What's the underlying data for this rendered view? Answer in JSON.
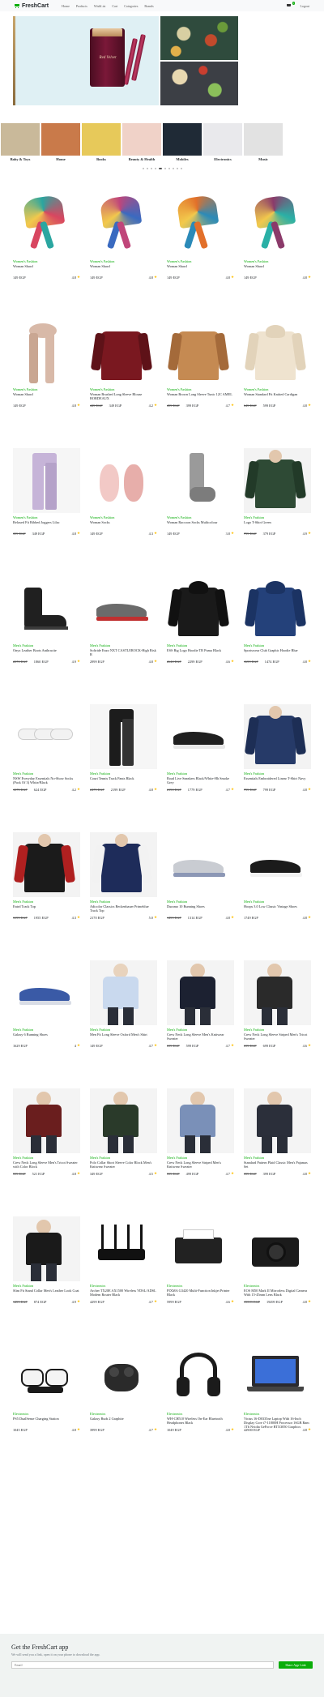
{
  "navbar": {
    "brand": "FreshCart",
    "links": [
      "Home",
      "Products",
      "WishList",
      "Cart",
      "Categories",
      "Brands"
    ],
    "cart_count": "1",
    "signout": "Logout"
  },
  "hero": {
    "tin_label": "Red Velvet"
  },
  "categories": [
    {
      "name": "Baby & Toys",
      "color": "#c9b99a"
    },
    {
      "name": "Home",
      "color": "#c97a4a"
    },
    {
      "name": "Books",
      "color": "#e7c95a"
    },
    {
      "name": "Beauty & Health",
      "color": "#f0d2c8"
    },
    {
      "name": "Mobiles",
      "color": "#1f2a36"
    },
    {
      "name": "Electronics",
      "color": "#e9e9ec"
    },
    {
      "name": "Music",
      "color": "#e2e2e2"
    }
  ],
  "products": [
    {
      "category": "Women's Fashion",
      "title": "Woman Shawl",
      "old_price": "",
      "price": "149 EGP",
      "rating": "4.8",
      "img": "scarf",
      "c1": "#2aa6a0",
      "c2": "#d84660"
    },
    {
      "category": "Women's Fashion",
      "title": "Woman Shawl",
      "old_price": "",
      "price": "149 EGP",
      "rating": "4.8",
      "img": "scarf",
      "c1": "#c0467a",
      "c2": "#3a6ac0"
    },
    {
      "category": "Women's Fashion",
      "title": "Woman Shawl",
      "old_price": "",
      "price": "149 EGP",
      "rating": "4.8",
      "img": "scarf",
      "c1": "#e2702a",
      "c2": "#2b8ab8"
    },
    {
      "category": "Women's Fashion",
      "title": "Woman Shawl",
      "old_price": "",
      "price": "149 EGP",
      "rating": "4.8",
      "img": "scarf",
      "c1": "#8b3a6a",
      "c2": "#2ab0a6"
    },
    {
      "category": "Women's Fashion",
      "title": "Woman Shawl",
      "old_price": "",
      "price": "149 EGP",
      "rating": "4.8",
      "img": "longscarf",
      "c1": "#d8b9a8",
      "c2": "#c9a692"
    },
    {
      "category": "Women's Fashion",
      "title": "Woman Brushed Long Sleeve Blouse BORDEAUX",
      "old_price": "449 EGP",
      "price": "349 EGP",
      "rating": "4.2",
      "img": "shirt",
      "c1": "#7a1820",
      "c2": "#5e1218"
    },
    {
      "category": "Women's Fashion",
      "title": "Woman Brown Long Sleeve Tunic 12C AMEL",
      "old_price": "499 EGP",
      "price": "399 EGP",
      "rating": "4.7",
      "img": "shirt",
      "c1": "#c58a52",
      "c2": "#a46a3a"
    },
    {
      "category": "Women's Fashion",
      "title": "Woman Standard Fit Knitted Cardigan",
      "old_price": "649 EGP",
      "price": "599 EGP",
      "rating": "4.8",
      "img": "hoodie",
      "c1": "#efe3cf",
      "c2": "#e2d3ba"
    },
    {
      "category": "Women's Fashion",
      "title": "Relaxed Fit Ribbed Joggers Lilac",
      "old_price": "399 EGP",
      "price": "349 EGP",
      "rating": "4.8",
      "img": "jogger",
      "c1": "#c6b4d8",
      "c2": "#b5a2c9"
    },
    {
      "category": "Women's Fashion",
      "title": "Woman Socks",
      "old_price": "",
      "price": "149 EGP",
      "rating": "4.3",
      "img": "slipper",
      "c1": "#f2c9c6",
      "c2": "#e7aeaa"
    },
    {
      "category": "Women's Fashion",
      "title": "Woman Raccoon Socks Multicolour",
      "old_price": "",
      "price": "149 EGP",
      "rating": "3.8",
      "img": "sock",
      "c1": "#9a9a9a",
      "c2": "#7c7c7c"
    },
    {
      "category": "Men's Fashion",
      "title": "Logo T-Shirt Green",
      "old_price": "799 EGP",
      "price": "379 EGP",
      "rating": "4.9",
      "img": "tee",
      "c1": "#2e4a35",
      "c2": "#223a28"
    },
    {
      "category": "Men's Fashion",
      "title": "Onyx Leather Boots Anthracite",
      "old_price": "2070 EGP",
      "price": "1860 EGP",
      "rating": "4.9",
      "img": "boot",
      "c1": "#202020",
      "c2": "#3a3a3a"
    },
    {
      "category": "Men's Fashion",
      "title": "Softride Enzo NXT CASTLEROCK-High Risk R",
      "old_price": "",
      "price": "2999 EGP",
      "rating": "4.8",
      "img": "shoe",
      "c1": "#6b6b6b",
      "c2": "#c03030"
    },
    {
      "category": "Men's Fashion",
      "title": "ESS Big Logo Hoodie TR Puma Black",
      "old_price": "2640 EGP",
      "price": "2299 EGP",
      "rating": "4.6",
      "img": "hoodie",
      "c1": "#1a1a1a",
      "c2": "#111"
    },
    {
      "category": "Men's Fashion",
      "title": "Sportswear Club Graphic Hoodie Blue",
      "old_price": "1699 EGP",
      "price": "1474 EGP",
      "rating": "4.8",
      "img": "hoodie",
      "c1": "#24417a",
      "c2": "#1b3363"
    },
    {
      "category": "Men's Fashion",
      "title": "NSW Everyday Essentials No-Show Socks (Pack Of 3) White/Black",
      "old_price": "1075 EGP",
      "price": "624 EGP",
      "rating": "4.2",
      "img": "socks3",
      "c1": "#f2f2f2",
      "c2": "#222"
    },
    {
      "category": "Men's Fashion",
      "title": "Court Tennis Track Pants Black",
      "old_price": "2479 EGP",
      "price": "2199 EGP",
      "rating": "4.8",
      "img": "pants",
      "c1": "#1c1c1c",
      "c2": "#333"
    },
    {
      "category": "Men's Fashion",
      "title": "Road Live Sneakers Black/White-Hh Smoke Grey",
      "old_price": "2190 EGP",
      "price": "1779 EGP",
      "rating": "4.7",
      "img": "shoe",
      "c1": "#1f1f1f",
      "c2": "#e8e8e8"
    },
    {
      "category": "Men's Fashion",
      "title": "Essentials Embroidered Linear T-Shirt Navy",
      "old_price": "799 EGP",
      "price": "799 EGP",
      "rating": "4.8",
      "img": "tee",
      "c1": "#263a68",
      "c2": "#1d2e55"
    },
    {
      "category": "Men's Fashion",
      "title": "Entrd Track Top",
      "old_price": "3199 EGP",
      "price": "1955 EGP",
      "rating": "4.3",
      "img": "jacket",
      "c1": "#1b1b1b",
      "c2": "#b02020"
    },
    {
      "category": "Men's Fashion",
      "title": "Adicolor Classics Beckenbauer Primeblue Track Top",
      "old_price": "",
      "price": "2170 EGP",
      "rating": "5.0",
      "img": "jacket",
      "c1": "#1e2c5a",
      "c2": "#f2f2f2"
    },
    {
      "category": "Men's Fashion",
      "title": "Duramo 10 Running Shoes",
      "old_price": "1499 EGP",
      "price": "1314 EGP",
      "rating": "4.8",
      "img": "shoe",
      "c1": "#c9ccd2",
      "c2": "#8c97b5"
    },
    {
      "category": "Men's Fashion",
      "title": "Hoops 3.0 Low Classic Vintage Shoes",
      "old_price": "",
      "price": "1749 EGP",
      "rating": "4.8",
      "img": "shoe",
      "c1": "#1b1b1b",
      "c2": "#f2f2f2"
    },
    {
      "category": "Men's Fashion",
      "title": "Galaxy 6 Running Shoes",
      "old_price": "",
      "price": "1629 EGP",
      "rating": "4",
      "img": "shoe",
      "c1": "#3a5aa6",
      "c2": "#d9dde6"
    },
    {
      "category": "Men's Fashion",
      "title": "Men Fit Long Sleeve Oxford Men's Shirt",
      "old_price": "",
      "price": "149 EGP",
      "rating": "4.7",
      "img": "manshirt",
      "c1": "#c9d9ee",
      "c2": "#e8d3bd"
    },
    {
      "category": "Men's Fashion",
      "title": "Crew Neck Long Sleeve Men's Knitwear Sweater",
      "old_price": "699 EGP",
      "price": "599 EGP",
      "rating": "4.7",
      "img": "mansweater",
      "c1": "#1c2131",
      "c2": "#e2c7ad"
    },
    {
      "category": "Men's Fashion",
      "title": "Crew Neck Long Sleeve Striped Men's Tricot Sweater",
      "old_price": "699 EGP",
      "price": "699 EGP",
      "rating": "4.6",
      "img": "mansweater",
      "c1": "#2a2a2a",
      "c2": "#e2c7ad"
    },
    {
      "category": "Men's Fashion",
      "title": "Crew Neck Long Sleeve Men's Tricot Sweater with Color Block",
      "old_price": "599 EGP",
      "price": "521 EGP",
      "rating": "4.8",
      "img": "mansweater",
      "c1": "#6a1e1e",
      "c2": "#e2c7ad"
    },
    {
      "category": "Men's Fashion",
      "title": "Polo Collar Short Sleeve Color Block Men's Knitwear Sweater",
      "old_price": "",
      "price": "349 EGP",
      "rating": "4.5",
      "img": "mansweater",
      "c1": "#2a3a2a",
      "c2": "#e2c7ad"
    },
    {
      "category": "Men's Fashion",
      "title": "Crew Neck Long Sleeve Striped Men's Knitwear Sweater",
      "old_price": "599 EGP",
      "price": "499 EGP",
      "rating": "4.7",
      "img": "mansweater",
      "c1": "#7a90b8",
      "c2": "#e2c7ad"
    },
    {
      "category": "Men's Fashion",
      "title": "Standard Pattern Plaid Classic Men's Pajamas Set",
      "old_price": "399 EGP",
      "price": "399 EGP",
      "rating": "4.8",
      "img": "mansweater",
      "c1": "#2b2f3a",
      "c2": "#e2c7ad"
    },
    {
      "category": "Men's Fashion",
      "title": "Slim Fit Stand Collar Men's Leather Look Coat",
      "old_price": "1499 EGP",
      "price": "874 EGP",
      "rating": "4.9",
      "img": "mansweater",
      "c1": "#1a1a1a",
      "c2": "#e2c7ad"
    },
    {
      "category": "Electronics",
      "title": "Archer TX20E AX1500 Wireless VDSL/ADSL Modem Router Black",
      "old_price": "",
      "price": "4299 EGP",
      "rating": "4.7",
      "img": "router",
      "c1": "#111",
      "c2": "#333"
    },
    {
      "category": "Electronics",
      "title": "PIXMA G3420 Multi-Function Inkjet Printer Black",
      "old_price": "",
      "price": "5999 EGP",
      "rating": "4.6",
      "img": "printer",
      "c1": "#222",
      "c2": "#444"
    },
    {
      "category": "Electronics",
      "title": "EOS M50 Mark II Mirrorless Digital Camera With 15-45mm Lens Black",
      "old_price": "19599 EGP",
      "price": "19499 EGP",
      "rating": "4.8",
      "img": "camera",
      "c1": "#1b1b1b",
      "c2": "#333"
    },
    {
      "category": "Electronics",
      "title": "PS5 DualSense Charging Station",
      "old_price": "",
      "price": "1045 EGP",
      "rating": "4.8",
      "img": "ps5",
      "c1": "#f4f4f4",
      "c2": "#1a1a1a"
    },
    {
      "category": "Electronics",
      "title": "Galaxy Buds 2 Graphite",
      "old_price": "",
      "price": "3999 EGP",
      "rating": "4.7",
      "img": "buds",
      "c1": "#2a2a2a",
      "c2": "#444"
    },
    {
      "category": "Electronics",
      "title": "WH-CH510 Wireless On-Ear Bluetooth Headphones Black",
      "old_price": "",
      "price": "1049 EGP",
      "rating": "4.8",
      "img": "headphone",
      "c1": "#1b1b1b",
      "c2": "#333"
    },
    {
      "category": "Electronics",
      "title": "Victus 16-D0335ne Laptop With 16-Inch Display Core i7-11800H Processor 16GB Ram 1Tb Nvidia GeForce RTX3050 Graphics English/Arabic Ceramic White",
      "old_price": "",
      "price": "42900 EGP",
      "rating": "4.8",
      "img": "laptop",
      "c1": "#2a2a30",
      "c2": "#3b6fd8"
    }
  ],
  "footer": {
    "title": "Get the FreshCart app",
    "subtitle": "We will send you a link, open it on your phone to download the app.",
    "email_placeholder": "Email",
    "button": "Share App Link"
  }
}
